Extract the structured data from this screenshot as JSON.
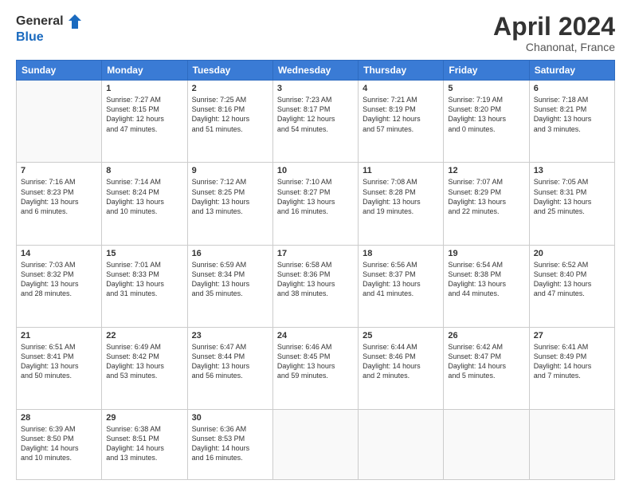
{
  "logo": {
    "line1": "General",
    "line2": "Blue"
  },
  "title": {
    "month": "April 2024",
    "location": "Chanonat, France"
  },
  "weekdays": [
    "Sunday",
    "Monday",
    "Tuesday",
    "Wednesday",
    "Thursday",
    "Friday",
    "Saturday"
  ],
  "weeks": [
    [
      {
        "day": "",
        "info": ""
      },
      {
        "day": "1",
        "info": "Sunrise: 7:27 AM\nSunset: 8:15 PM\nDaylight: 12 hours\nand 47 minutes."
      },
      {
        "day": "2",
        "info": "Sunrise: 7:25 AM\nSunset: 8:16 PM\nDaylight: 12 hours\nand 51 minutes."
      },
      {
        "day": "3",
        "info": "Sunrise: 7:23 AM\nSunset: 8:17 PM\nDaylight: 12 hours\nand 54 minutes."
      },
      {
        "day": "4",
        "info": "Sunrise: 7:21 AM\nSunset: 8:19 PM\nDaylight: 12 hours\nand 57 minutes."
      },
      {
        "day": "5",
        "info": "Sunrise: 7:19 AM\nSunset: 8:20 PM\nDaylight: 13 hours\nand 0 minutes."
      },
      {
        "day": "6",
        "info": "Sunrise: 7:18 AM\nSunset: 8:21 PM\nDaylight: 13 hours\nand 3 minutes."
      }
    ],
    [
      {
        "day": "7",
        "info": "Sunrise: 7:16 AM\nSunset: 8:23 PM\nDaylight: 13 hours\nand 6 minutes."
      },
      {
        "day": "8",
        "info": "Sunrise: 7:14 AM\nSunset: 8:24 PM\nDaylight: 13 hours\nand 10 minutes."
      },
      {
        "day": "9",
        "info": "Sunrise: 7:12 AM\nSunset: 8:25 PM\nDaylight: 13 hours\nand 13 minutes."
      },
      {
        "day": "10",
        "info": "Sunrise: 7:10 AM\nSunset: 8:27 PM\nDaylight: 13 hours\nand 16 minutes."
      },
      {
        "day": "11",
        "info": "Sunrise: 7:08 AM\nSunset: 8:28 PM\nDaylight: 13 hours\nand 19 minutes."
      },
      {
        "day": "12",
        "info": "Sunrise: 7:07 AM\nSunset: 8:29 PM\nDaylight: 13 hours\nand 22 minutes."
      },
      {
        "day": "13",
        "info": "Sunrise: 7:05 AM\nSunset: 8:31 PM\nDaylight: 13 hours\nand 25 minutes."
      }
    ],
    [
      {
        "day": "14",
        "info": "Sunrise: 7:03 AM\nSunset: 8:32 PM\nDaylight: 13 hours\nand 28 minutes."
      },
      {
        "day": "15",
        "info": "Sunrise: 7:01 AM\nSunset: 8:33 PM\nDaylight: 13 hours\nand 31 minutes."
      },
      {
        "day": "16",
        "info": "Sunrise: 6:59 AM\nSunset: 8:34 PM\nDaylight: 13 hours\nand 35 minutes."
      },
      {
        "day": "17",
        "info": "Sunrise: 6:58 AM\nSunset: 8:36 PM\nDaylight: 13 hours\nand 38 minutes."
      },
      {
        "day": "18",
        "info": "Sunrise: 6:56 AM\nSunset: 8:37 PM\nDaylight: 13 hours\nand 41 minutes."
      },
      {
        "day": "19",
        "info": "Sunrise: 6:54 AM\nSunset: 8:38 PM\nDaylight: 13 hours\nand 44 minutes."
      },
      {
        "day": "20",
        "info": "Sunrise: 6:52 AM\nSunset: 8:40 PM\nDaylight: 13 hours\nand 47 minutes."
      }
    ],
    [
      {
        "day": "21",
        "info": "Sunrise: 6:51 AM\nSunset: 8:41 PM\nDaylight: 13 hours\nand 50 minutes."
      },
      {
        "day": "22",
        "info": "Sunrise: 6:49 AM\nSunset: 8:42 PM\nDaylight: 13 hours\nand 53 minutes."
      },
      {
        "day": "23",
        "info": "Sunrise: 6:47 AM\nSunset: 8:44 PM\nDaylight: 13 hours\nand 56 minutes."
      },
      {
        "day": "24",
        "info": "Sunrise: 6:46 AM\nSunset: 8:45 PM\nDaylight: 13 hours\nand 59 minutes."
      },
      {
        "day": "25",
        "info": "Sunrise: 6:44 AM\nSunset: 8:46 PM\nDaylight: 14 hours\nand 2 minutes."
      },
      {
        "day": "26",
        "info": "Sunrise: 6:42 AM\nSunset: 8:47 PM\nDaylight: 14 hours\nand 5 minutes."
      },
      {
        "day": "27",
        "info": "Sunrise: 6:41 AM\nSunset: 8:49 PM\nDaylight: 14 hours\nand 7 minutes."
      }
    ],
    [
      {
        "day": "28",
        "info": "Sunrise: 6:39 AM\nSunset: 8:50 PM\nDaylight: 14 hours\nand 10 minutes."
      },
      {
        "day": "29",
        "info": "Sunrise: 6:38 AM\nSunset: 8:51 PM\nDaylight: 14 hours\nand 13 minutes."
      },
      {
        "day": "30",
        "info": "Sunrise: 6:36 AM\nSunset: 8:53 PM\nDaylight: 14 hours\nand 16 minutes."
      },
      {
        "day": "",
        "info": ""
      },
      {
        "day": "",
        "info": ""
      },
      {
        "day": "",
        "info": ""
      },
      {
        "day": "",
        "info": ""
      }
    ]
  ]
}
